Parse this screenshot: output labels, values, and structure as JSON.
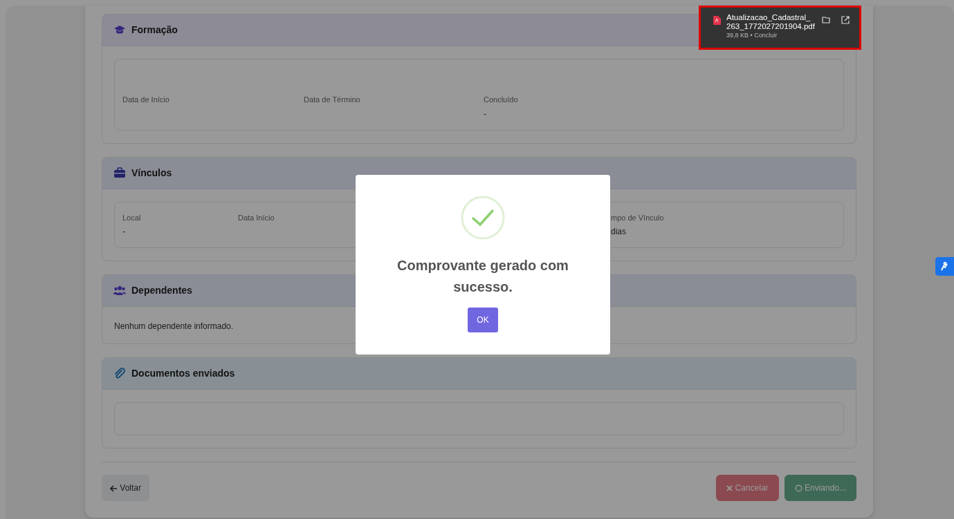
{
  "sections": [
    {
      "kind": "education",
      "title": "Formação",
      "fields": [
        {
          "label": "Data de Início"
        },
        {
          "label": "Data de Término"
        },
        {
          "label": "Concluído",
          "value": "-"
        }
      ]
    },
    {
      "kind": "links",
      "title": "Vínculos",
      "fields": [
        {
          "label": "Local",
          "value": "-"
        },
        {
          "label": "Data Início"
        },
        {
          "label": "mpo de Vínculo",
          "value": "dias"
        }
      ]
    },
    {
      "kind": "dependents",
      "title": "Dependentes",
      "text": "Nenhum dependente informado."
    },
    {
      "kind": "documents",
      "title": "Documentos enviados"
    }
  ],
  "footer": {
    "back": {
      "label": "Voltar"
    },
    "cancel": {
      "label": "Cancelar",
      "disabled": true
    },
    "send": {
      "label": "Enviando...",
      "disabled": true
    }
  },
  "modal": {
    "message": "Comprovante gerado com sucesso.",
    "button": "OK"
  },
  "download": {
    "name_lines": [
      "Atualizacao_Cadastral_",
      "263_1772027201904.pdf"
    ],
    "meta": "39,8 KB • Concluir"
  }
}
